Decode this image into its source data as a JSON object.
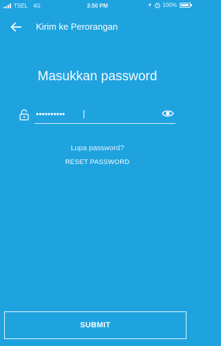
{
  "status_bar": {
    "carrier": "TSEL",
    "network": "4G",
    "time": "3:50 PM",
    "battery": "100%",
    "icons": [
      "signal-icon",
      "location-arrow-icon",
      "alarm-icon",
      "battery-icon"
    ]
  },
  "header": {
    "title": "Kirim ke Perorangan",
    "back_icon": "arrow-left-icon"
  },
  "main": {
    "heading": "Masukkan password",
    "password": {
      "value": "••••••••••",
      "lock_icon": "lock-icon",
      "visibility_icon": "eye-icon"
    },
    "forgot_text": "Lupa password?",
    "reset_label": "RESET PASSWORD"
  },
  "footer": {
    "submit_label": "SUBMIT"
  },
  "colors": {
    "background": "#1fa3df",
    "text": "#ffffff"
  }
}
